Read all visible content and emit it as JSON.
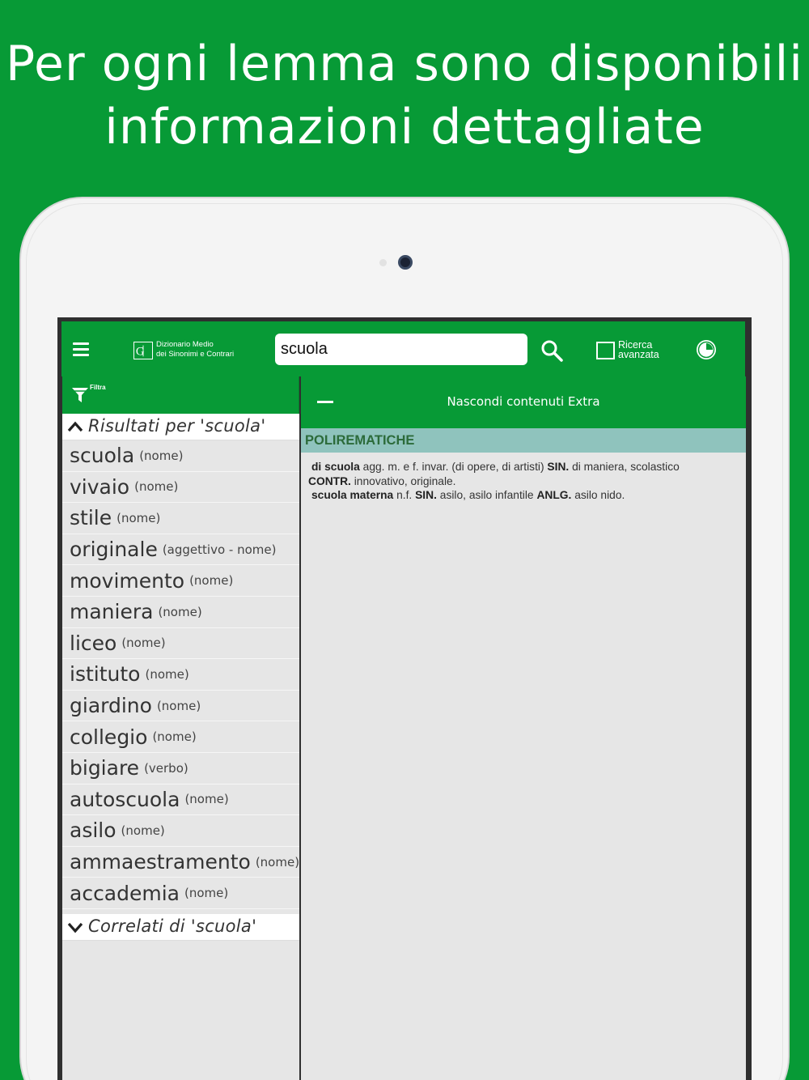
{
  "headline": {
    "line1": "Per ogni lemma sono disponibili",
    "line2": "informazioni dettagliate"
  },
  "app": {
    "logo_line1": "Dizionario Medio",
    "logo_line2": "dei Sinonimi e Contrari",
    "search_value": "scuola",
    "advanced_line1": "Ricerca",
    "advanced_line2": "avanzata",
    "filter_label": "Filtra"
  },
  "results": {
    "header": "Risultati per 'scuola'",
    "items": [
      {
        "word": "scuola",
        "pos": "(nome)"
      },
      {
        "word": "vivaio",
        "pos": "(nome)"
      },
      {
        "word": "stile",
        "pos": "(nome)"
      },
      {
        "word": "originale",
        "pos": "(aggettivo - nome)"
      },
      {
        "word": "movimento",
        "pos": "(nome)"
      },
      {
        "word": "maniera",
        "pos": "(nome)"
      },
      {
        "word": "liceo",
        "pos": "(nome)"
      },
      {
        "word": "istituto",
        "pos": "(nome)"
      },
      {
        "word": "giardino",
        "pos": "(nome)"
      },
      {
        "word": "collegio",
        "pos": "(nome)"
      },
      {
        "word": "bigiare",
        "pos": "(verbo)"
      },
      {
        "word": "autoscuola",
        "pos": "(nome)"
      },
      {
        "word": "asilo",
        "pos": "(nome)"
      },
      {
        "word": "ammaestramento",
        "pos": "(nome)"
      },
      {
        "word": "accademia",
        "pos": "(nome)"
      }
    ],
    "related_header": "Correlati di 'scuola'"
  },
  "detail": {
    "extra_toggle": "Nascondi contenuti Extra",
    "section_title": "POLIREMATICHE",
    "entry1": {
      "head": "di scuola",
      "gram": "agg. m. e f. invar. (di opere, di artisti)",
      "sin_label": "SIN.",
      "sin": "di maniera, scolastico",
      "contr_label": "CONTR.",
      "contr": "innovativo, originale."
    },
    "entry2": {
      "head": "scuola materna",
      "gram": "n.f.",
      "sin_label": "SIN.",
      "sin": "asilo, asilo infantile",
      "anlg_label": "ANLG.",
      "anlg": "asilo nido."
    }
  },
  "colors": {
    "brand_green": "#079a36",
    "section_teal": "#8fc3bd",
    "pane_gray": "#e6e6e6"
  },
  "icons": [
    "menu-icon",
    "logo-icon",
    "search-icon",
    "checkbox-icon",
    "history-icon",
    "filter-icon",
    "chevron-up-icon",
    "chevron-down-icon",
    "minus-icon"
  ]
}
